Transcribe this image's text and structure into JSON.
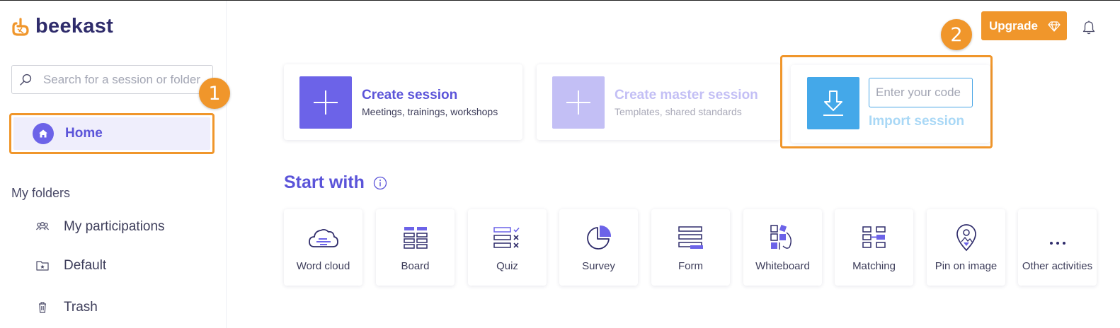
{
  "brand": {
    "name": "beekast",
    "logo_color": "#f0962b",
    "text_color": "#2f2c6b"
  },
  "search": {
    "placeholder": "Search for a session or folder"
  },
  "sidebar": {
    "home_label": "Home",
    "folders_title": "My folders",
    "items": [
      {
        "label": "My participations",
        "icon": "participants-icon"
      },
      {
        "label": "Default",
        "icon": "folder-star-icon"
      },
      {
        "label": "Trash",
        "icon": "trash-icon"
      }
    ]
  },
  "header": {
    "upgrade_label": "Upgrade"
  },
  "annotations": {
    "badge_1": "1",
    "badge_2": "2",
    "highlight_color": "#f0962b"
  },
  "sessions": {
    "create": {
      "title": "Create session",
      "subtitle": "Meetings, trainings, workshops",
      "color": "#6c63e8"
    },
    "master": {
      "title": "Create master session",
      "subtitle": "Templates, shared standards",
      "color": "#c3bff5"
    },
    "import": {
      "placeholder": "Enter your code",
      "label": "Import session",
      "color": "#44a8e9"
    }
  },
  "start_with": {
    "title": "Start with",
    "activities": [
      {
        "label": "Word cloud",
        "icon": "word-cloud-icon"
      },
      {
        "label": "Board",
        "icon": "board-icon"
      },
      {
        "label": "Quiz",
        "icon": "quiz-icon"
      },
      {
        "label": "Survey",
        "icon": "survey-icon"
      },
      {
        "label": "Form",
        "icon": "form-icon"
      },
      {
        "label": "Whiteboard",
        "icon": "whiteboard-icon"
      },
      {
        "label": "Matching",
        "icon": "matching-icon"
      },
      {
        "label": "Pin on image",
        "icon": "pin-on-image-icon"
      },
      {
        "label": "Other activities",
        "icon": "more-icon"
      }
    ]
  }
}
